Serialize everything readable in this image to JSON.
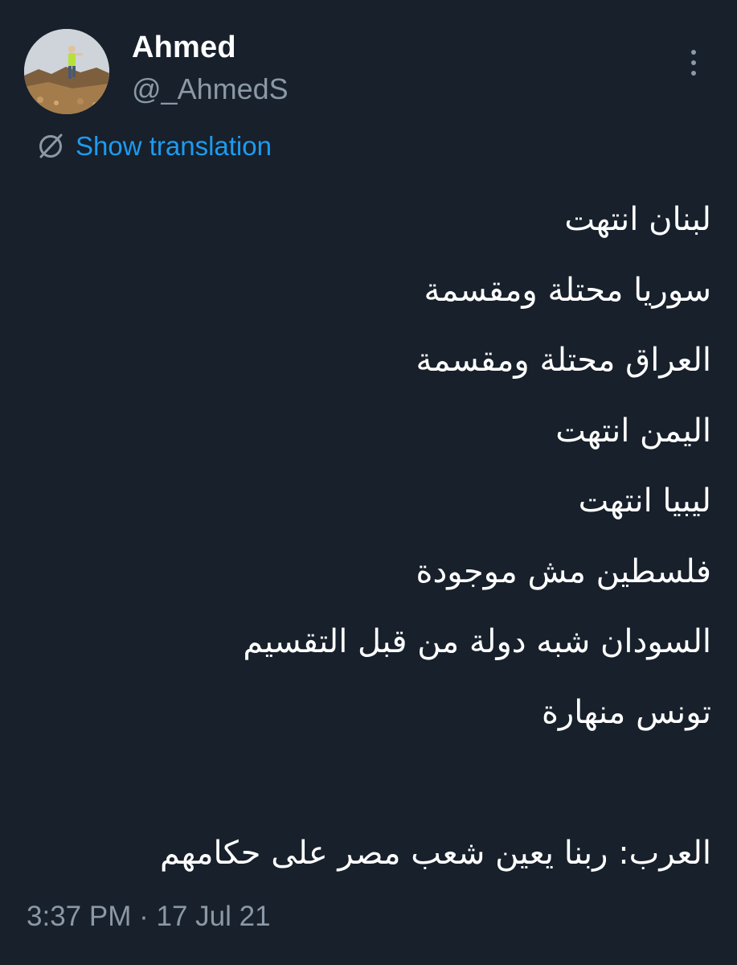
{
  "theme": {
    "background": "#17202b",
    "text_primary": "#ffffff",
    "text_secondary": "#8b98a5",
    "accent": "#1d9bf0"
  },
  "author": {
    "display_name": "Ahmed",
    "handle": "@_AhmedS",
    "avatar_icon": "profile-photo"
  },
  "actions": {
    "more_icon": "ellipsis-vertical-icon",
    "translate_icon": "translate-globe-icon",
    "translate_label": "Show translation"
  },
  "tweet": {
    "lines": [
      "لبنان انتهت",
      "سوريا محتلة ومقسمة",
      "العراق محتلة ومقسمة",
      "اليمن انتهت",
      "ليبيا انتهت",
      "فلسطين مش موجودة",
      "السودان شبه دولة من قبل التقسيم",
      "تونس منهارة"
    ],
    "final_line": "العرب: ربنا يعين شعب مصر على حكامهم"
  },
  "meta": {
    "time": "3:37 PM",
    "separator": "·",
    "date": "17 Jul 21"
  }
}
